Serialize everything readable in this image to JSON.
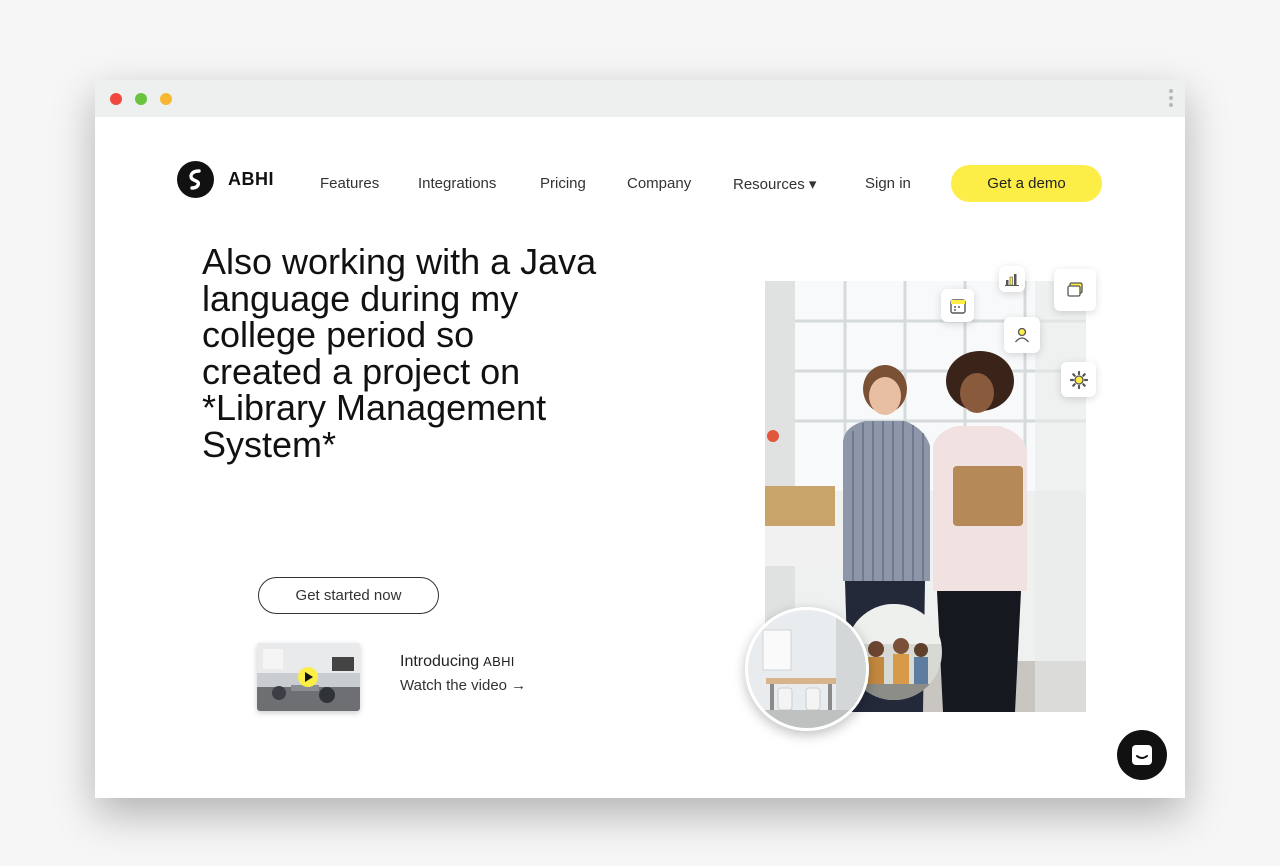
{
  "colors": {
    "accent": "#fcee46",
    "dark": "#111111"
  },
  "window": {
    "controls": [
      "close",
      "minimize",
      "maximize"
    ]
  },
  "header": {
    "brand": "ABHI",
    "nav": {
      "features": "Features",
      "integrations": "Integrations",
      "pricing": "Pricing",
      "company": "Company",
      "resources": "Resources ▾",
      "signin": "Sign in"
    },
    "cta": "Get a demo"
  },
  "hero": {
    "title": "Also working with a Java language during my college period so created a project on *Library Management System*",
    "cta": "Get started now",
    "video": {
      "intro": "Introducing",
      "brand": "ABHI",
      "watch": "Watch the video →"
    }
  },
  "floating_icons": [
    "calendar-icon",
    "bar-chart-icon",
    "chat-icon",
    "user-icon",
    "gear-icon"
  ]
}
